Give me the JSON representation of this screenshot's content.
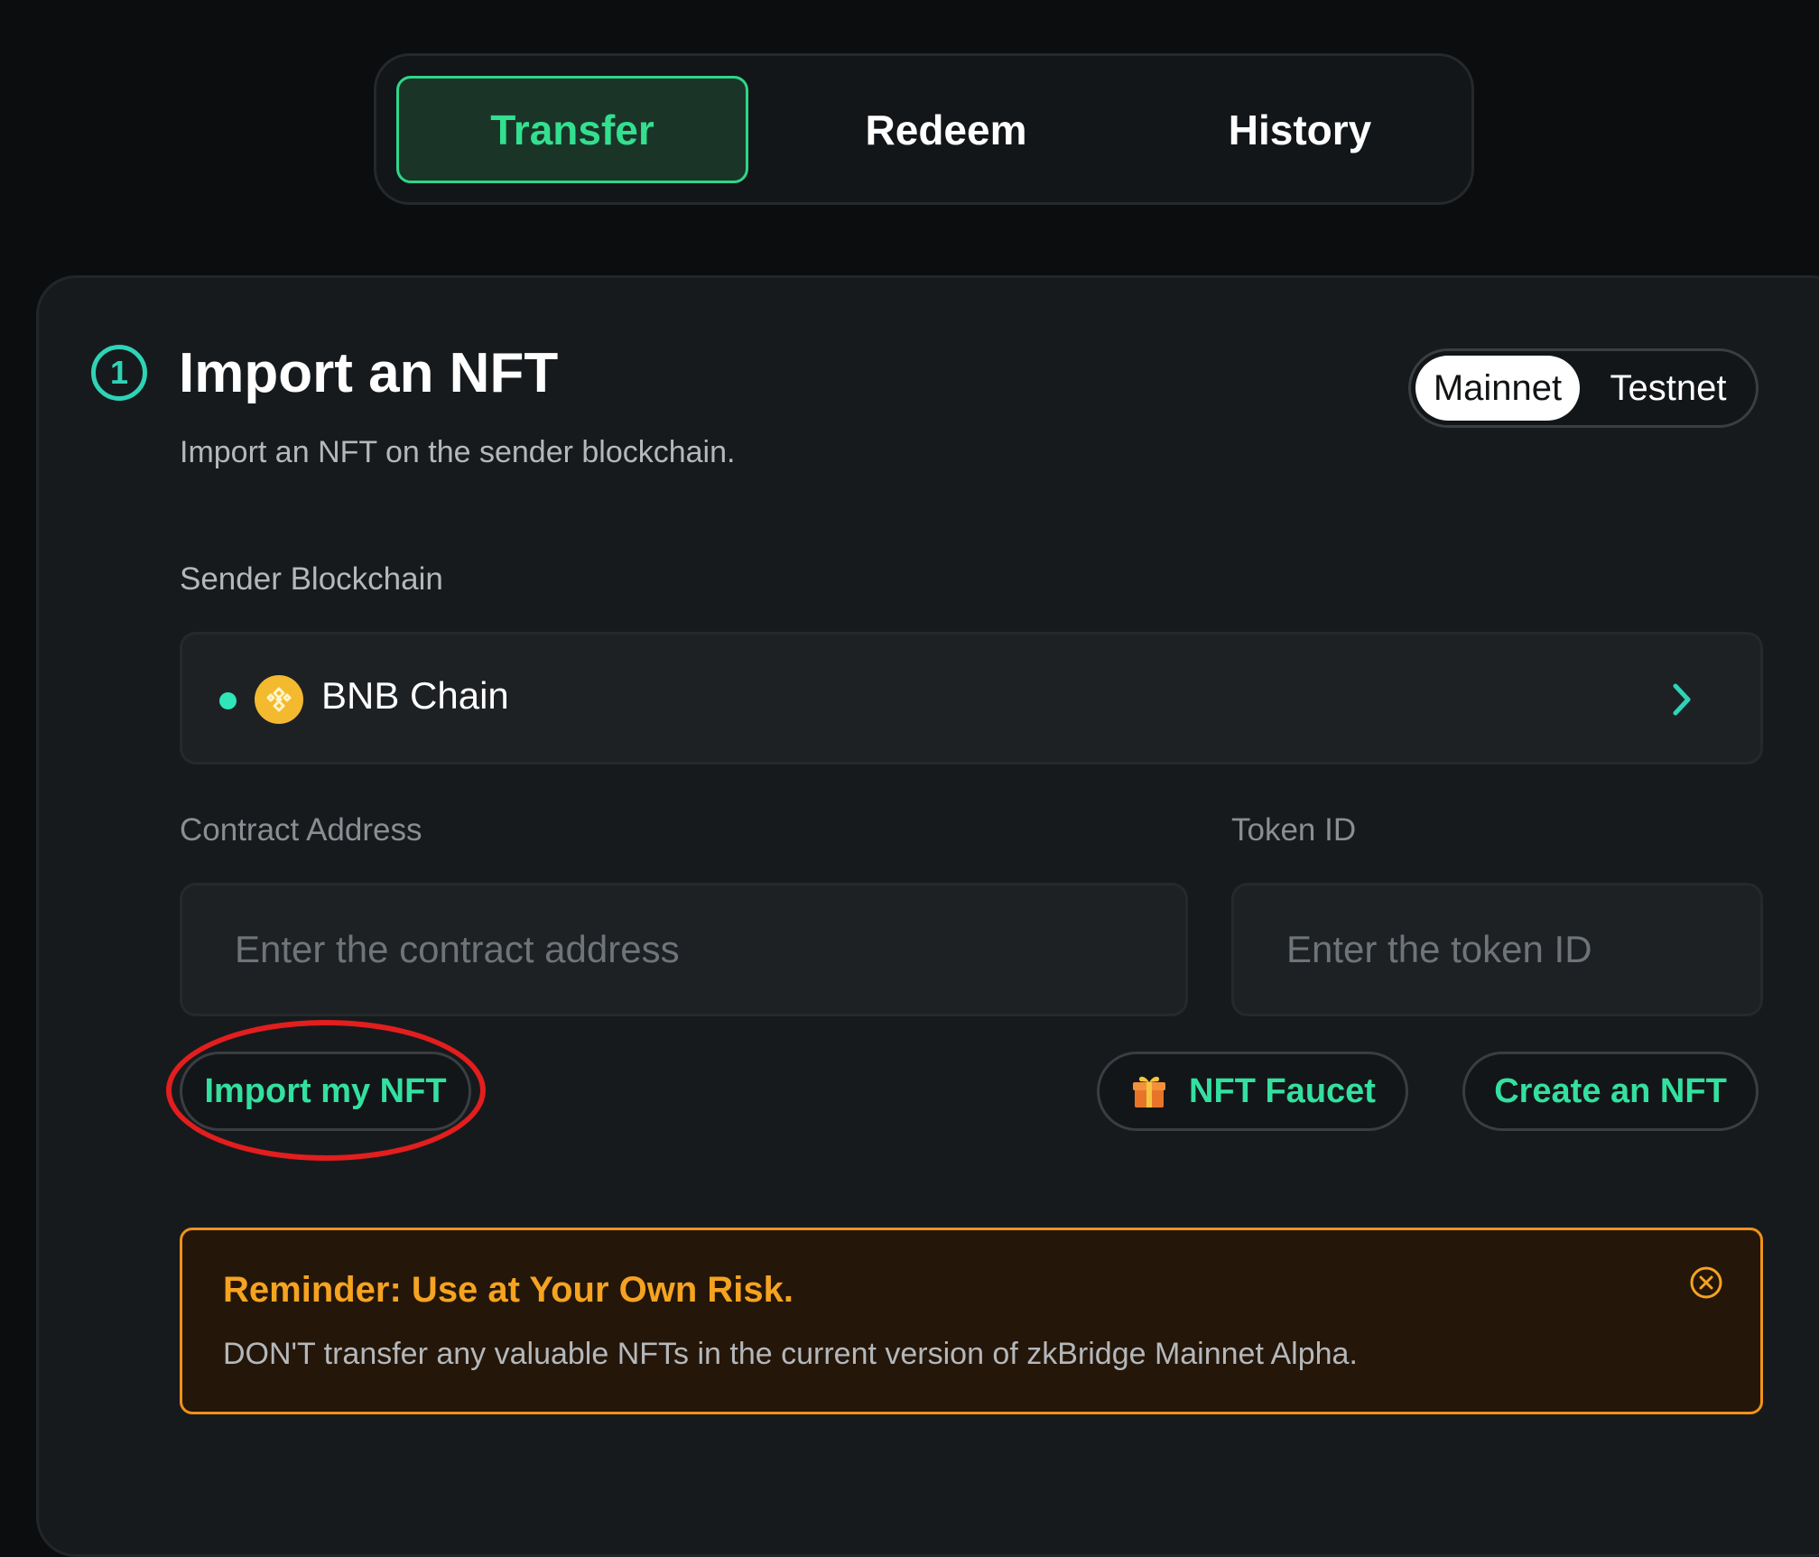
{
  "tabs": [
    {
      "label": "Transfer",
      "active": true
    },
    {
      "label": "Redeem",
      "active": false
    },
    {
      "label": "History",
      "active": false
    }
  ],
  "card": {
    "step_number": "1",
    "title": "Import an NFT",
    "subtitle": "Import an NFT on the sender blockchain.",
    "network_toggle": {
      "options": [
        "Mainnet",
        "Testnet"
      ],
      "selected": "Mainnet"
    },
    "sender_blockchain": {
      "label": "Sender Blockchain",
      "selected": "BNB Chain",
      "status_color": "#2fe6b8",
      "icon": "bnb-chain-icon"
    },
    "contract_address": {
      "label": "Contract Address",
      "placeholder": "Enter the contract address",
      "value": ""
    },
    "token_id": {
      "label": "Token ID",
      "placeholder": "Enter the token ID",
      "value": ""
    },
    "buttons": {
      "import": "Import my NFT",
      "faucet": "NFT Faucet",
      "create": "Create an NFT"
    },
    "alert": {
      "title": "Reminder: Use at Your Own Risk.",
      "body": "DON'T transfer any valuable NFTs in the current version of zkBridge Mainnet Alpha."
    }
  },
  "colors": {
    "accent_green": "#33e08f",
    "teal": "#2fd3b6",
    "warning_orange": "#f0921a",
    "annotation_red": "#e21e1e",
    "background": "#0b0d0f"
  }
}
